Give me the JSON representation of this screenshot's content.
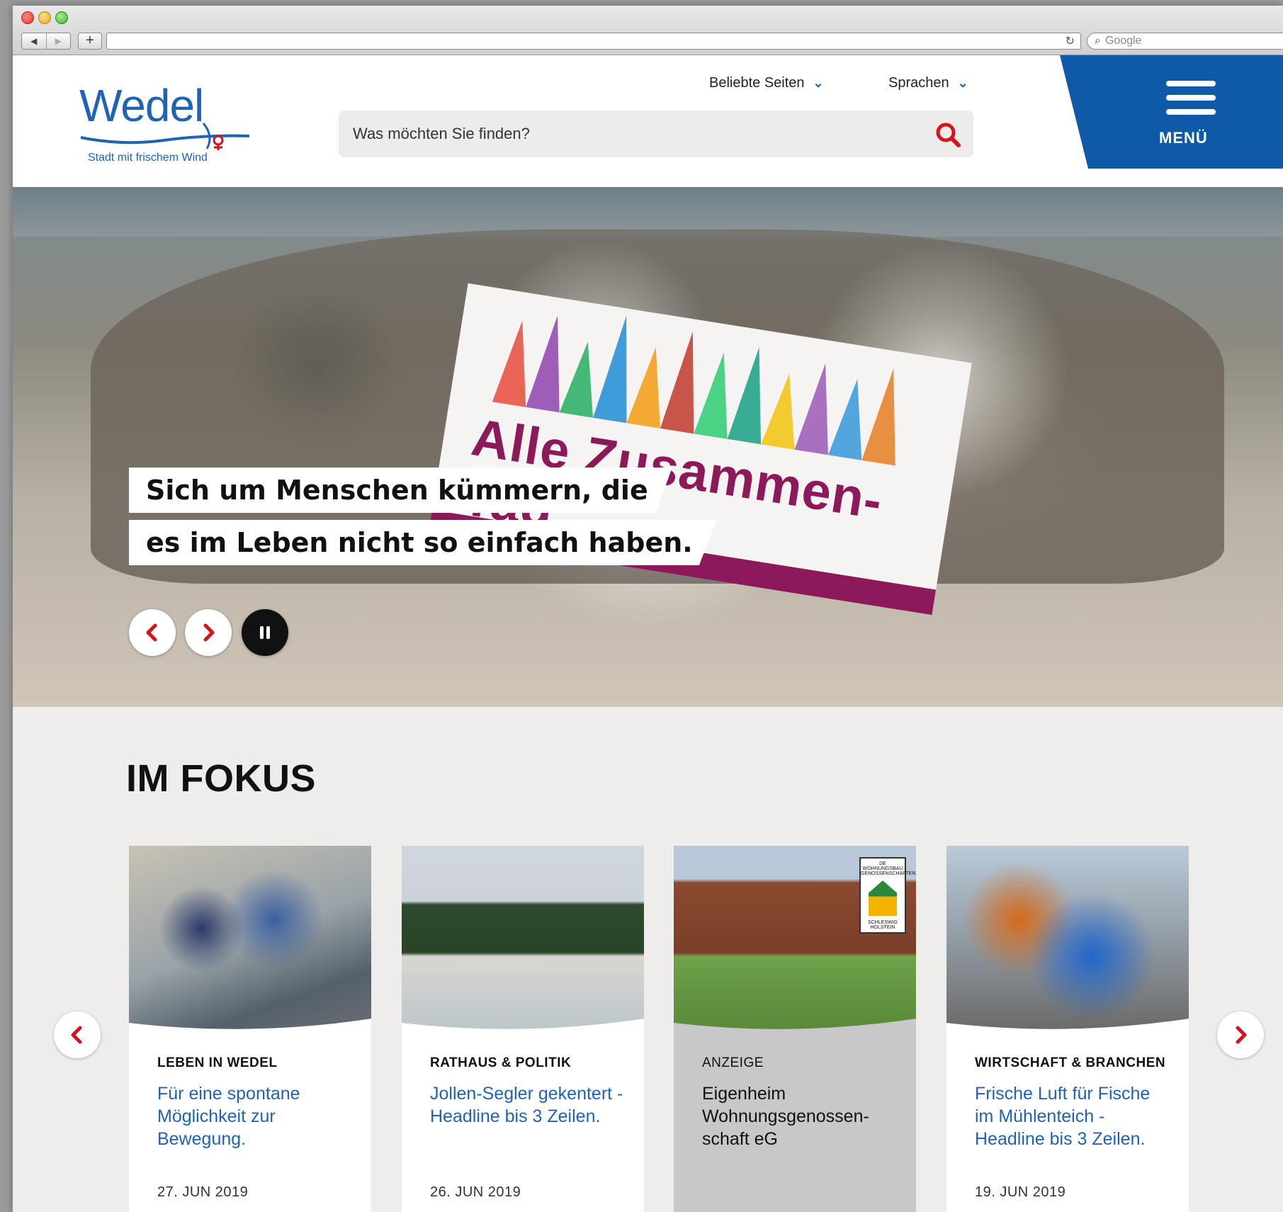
{
  "browser": {
    "search_placeholder": "Google",
    "nav_back": "◀",
    "nav_forward": "▶",
    "new_tab": "+",
    "reload": "↻",
    "search_icon": "magnifier-icon"
  },
  "header": {
    "logo_text": "Wedel",
    "logo_tagline": "Stadt mit frischem Wind",
    "links": [
      {
        "label": "Beliebte Seiten"
      },
      {
        "label": "Sprachen"
      }
    ],
    "search_placeholder": "Was möchten Sie finden?",
    "menu_label": "MENÜ",
    "accent_color": "#0f5aa8",
    "search_icon_color": "#d7131d"
  },
  "hero": {
    "caption_line1": "Sich um Menschen kümmern, die",
    "caption_line2": "es im Leben nicht so einfach haben.",
    "banner_text": "Alle Zusammen-Tag",
    "controls": [
      "prev",
      "next",
      "pause"
    ]
  },
  "fokus": {
    "title": "IM FOKUS",
    "cards": [
      {
        "category": "LEBEN IN WEDEL",
        "headline": "Für eine spontane Möglichkeit zur Bewegung.",
        "date": "27. JUN 2019"
      },
      {
        "category": "RATHAUS & POLITIK",
        "headline": "Jollen-Segler gekentert - Headline bis 3 Zeilen.",
        "date": "26. JUN 2019"
      },
      {
        "category": "ANZEIGE",
        "headline": "Eigenheim Wohnungsgenossen-schaft eG",
        "date": "",
        "badge_line1": "DE WOHNUNGSBAU GENOSSENSCHAFTEN",
        "badge_line2": "SCHLESWIG HOLSTEIN"
      },
      {
        "category": "WIRTSCHAFT & BRANCHEN",
        "headline": "Frische Luft für Fische im Mühlenteich - Headline bis 3 Zeilen.",
        "date": "19. JUN 2019"
      }
    ]
  }
}
